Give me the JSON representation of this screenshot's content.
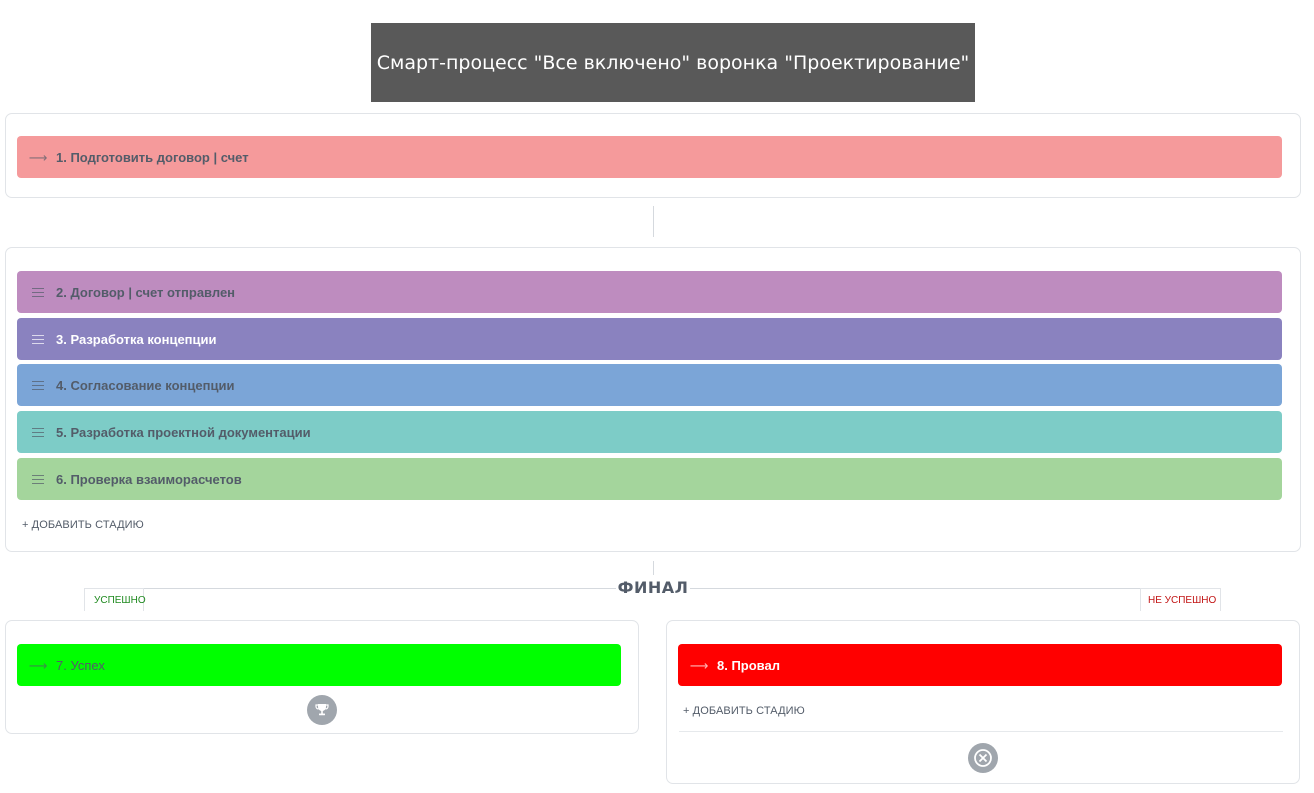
{
  "header": {
    "title": "Смарт-процесс \"Все включено\" воронка \"Проектирование\""
  },
  "first_stage": {
    "label": "1. Подготовить договор | счет",
    "color": "#f59a9b",
    "icon": "arrow-icon"
  },
  "stages": [
    {
      "label": "2. Договор | счет отправлен",
      "color": "#be8cbf",
      "text_color": "#535c69",
      "icon": "drag-handle-icon"
    },
    {
      "label": "3. Разработка концепции",
      "color": "#8a82bf",
      "text_color": "#ffffff",
      "icon": "drag-handle-icon"
    },
    {
      "label": "4. Согласование концепции",
      "color": "#7ba5d7",
      "text_color": "#535c69",
      "icon": "drag-handle-icon"
    },
    {
      "label": "5. Разработка проектной документации",
      "color": "#7dccc7",
      "text_color": "#535c69",
      "icon": "drag-handle-icon"
    },
    {
      "label": "6. Проверка взаиморасчетов",
      "color": "#a4d59c",
      "text_color": "#535c69",
      "icon": "drag-handle-icon"
    }
  ],
  "add_stage_label": "+ ДОБАВИТЬ СТАДИЮ",
  "final": {
    "title": "ФИНАЛ",
    "success_tab": "УСПЕШНО",
    "fail_tab": "НЕ УСПЕШНО",
    "success_color": "#1f8a1f",
    "fail_color": "#c21414",
    "success_stage": {
      "label": "7. Успех",
      "color": "#00ff00",
      "icon": "arrow-icon",
      "result_icon": "trophy-icon"
    },
    "fail_stage": {
      "label": "8. Провал",
      "color": "#ff0000",
      "icon": "arrow-icon",
      "result_icon": "cross-circle-icon"
    },
    "fail_add_label": "+ ДОБАВИТЬ СТАДИЮ"
  }
}
